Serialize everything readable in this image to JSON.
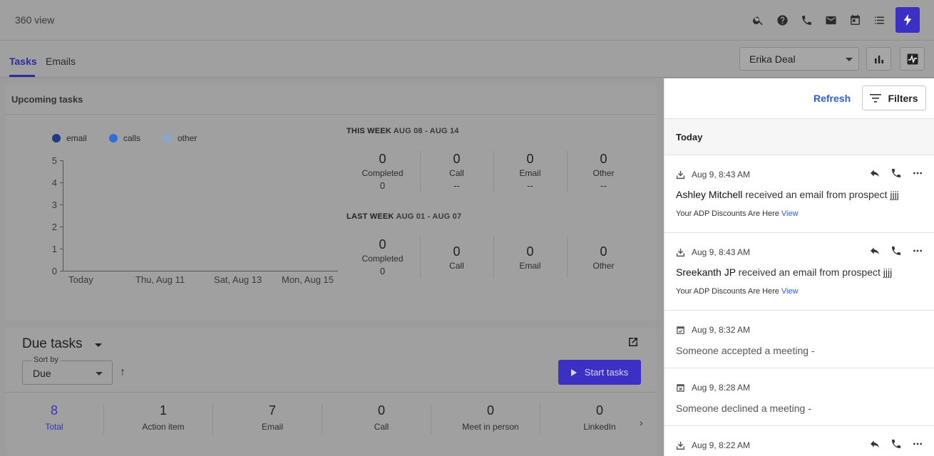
{
  "header": {
    "title": "360 view",
    "icons": [
      "search-icon",
      "help-icon",
      "phone-icon",
      "mail-icon",
      "calendar-icon",
      "tasks-icon",
      "bolt-icon"
    ]
  },
  "tabs": [
    {
      "label": "Tasks",
      "active": true
    },
    {
      "label": "Emails",
      "active": false
    }
  ],
  "deal_select": {
    "value": "Erika Deal"
  },
  "upcoming": {
    "title": "Upcoming tasks",
    "legend": [
      {
        "label": "email",
        "color": "#1c3d82"
      },
      {
        "label": "calls",
        "color": "#2f6fd8"
      },
      {
        "label": "other",
        "color": "#8aa6cf"
      }
    ],
    "this_week": {
      "title": "THIS WEEK",
      "range": "AUG 08 - AUG 14",
      "stats": [
        {
          "value": "0",
          "label": "Completed",
          "sub": "0"
        },
        {
          "value": "0",
          "label": "Call",
          "sub": "--"
        },
        {
          "value": "0",
          "label": "Email",
          "sub": "--"
        },
        {
          "value": "0",
          "label": "Other",
          "sub": "--"
        }
      ]
    },
    "last_week": {
      "title": "LAST WEEK",
      "range": "AUG 01 - AUG 07",
      "stats": [
        {
          "value": "0",
          "label": "Completed",
          "sub": "0"
        },
        {
          "value": "0",
          "label": "Call"
        },
        {
          "value": "0",
          "label": "Email"
        },
        {
          "value": "0",
          "label": "Other"
        }
      ]
    }
  },
  "chart_data": {
    "type": "bar",
    "categories": [
      "Today",
      "Thu, Aug 11",
      "Sat, Aug 13",
      "Mon, Aug 15"
    ],
    "series": [
      {
        "name": "email",
        "values": [
          0,
          0,
          0,
          0
        ]
      },
      {
        "name": "calls",
        "values": [
          0,
          0,
          0,
          0
        ]
      },
      {
        "name": "other",
        "values": [
          0,
          0,
          0,
          0
        ]
      }
    ],
    "yticks": [
      "0",
      "1",
      "2",
      "3",
      "4",
      "5"
    ],
    "ylim": [
      0,
      5
    ],
    "legend_position": "top-left",
    "title": "",
    "xlabel": "",
    "ylabel": ""
  },
  "due_tasks": {
    "title": "Due tasks",
    "sort_label": "Sort by",
    "sort_value": "Due",
    "start_label": "Start tasks",
    "counts": [
      {
        "value": "8",
        "label": "Total"
      },
      {
        "value": "1",
        "label": "Action item"
      },
      {
        "value": "7",
        "label": "Email"
      },
      {
        "value": "0",
        "label": "Call"
      },
      {
        "value": "0",
        "label": "Meet in person"
      },
      {
        "value": "0",
        "label": "LinkedIn"
      }
    ]
  },
  "activity": {
    "refresh_label": "Refresh",
    "filters_label": "Filters",
    "section": "Today",
    "items": [
      {
        "time": "Aug 9, 8:43 AM",
        "who": "Ashley Mitchell",
        "text": " received an email from prospect jjjj",
        "sub": "Your ADP Discounts Are Here",
        "link": "View"
      },
      {
        "time": "Aug 9, 8:43 AM",
        "who": "Sreekanth JP",
        "text": " received an email from prospect jjjj",
        "sub": "Your ADP Discounts Are Here",
        "link": "View"
      },
      {
        "time": "Aug 9, 8:32 AM",
        "text": "Someone accepted a meeting -"
      },
      {
        "time": "Aug 9, 8:28 AM",
        "text": "Someone declined a meeting -"
      },
      {
        "time": "Aug 9, 8:22 AM"
      }
    ]
  }
}
